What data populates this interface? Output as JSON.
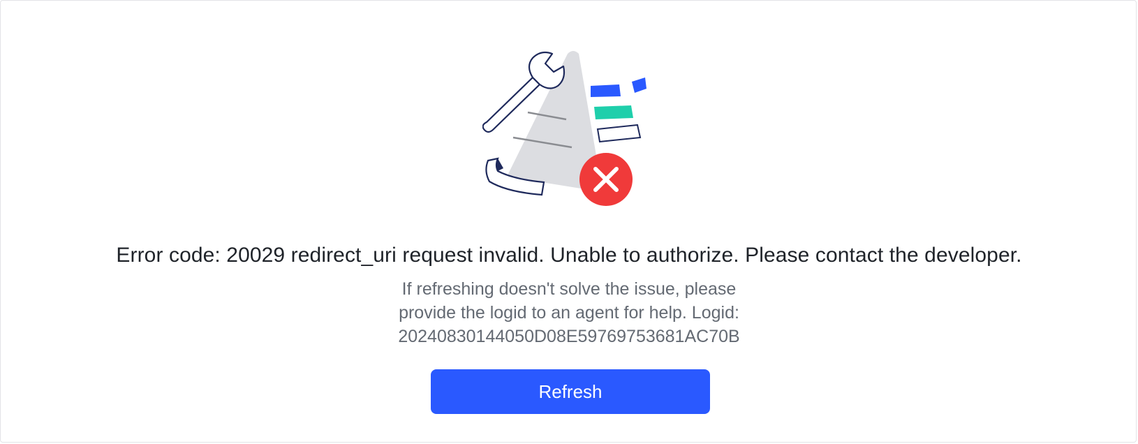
{
  "error": {
    "title": "Error code: 20029 redirect_uri request invalid. Unable to authorize. Please contact the developer.",
    "description_lines": [
      "If refreshing doesn't solve the issue, please",
      "provide the logid to an agent for help. Logid:",
      "20240830144050D08E59769753681AC70B"
    ]
  },
  "actions": {
    "refresh_label": "Refresh"
  },
  "colors": {
    "accent": "#2a59ff",
    "teal": "#1fcfab",
    "error_red": "#f03a3a",
    "outline": "#1f2a5c",
    "cone_gray": "#dcdde1"
  },
  "icons": {
    "illustration": "authorization-error-illustration",
    "badge": "error-x-icon"
  }
}
